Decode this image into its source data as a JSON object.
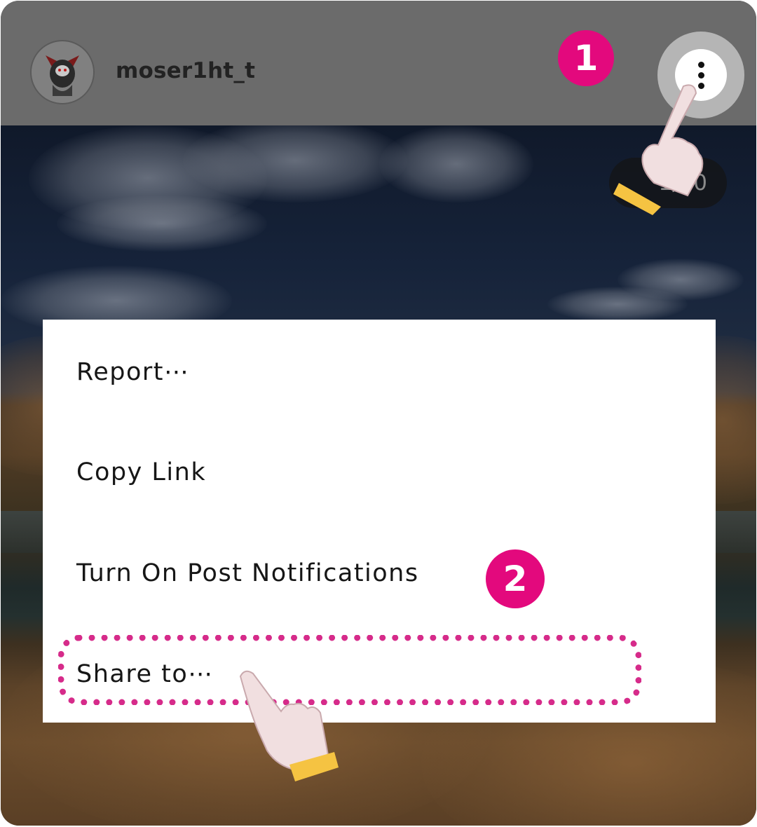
{
  "header": {
    "username": "moser1ht_t",
    "more_icon": "more-vertical-icon"
  },
  "post": {
    "counter": "1/10"
  },
  "steps": {
    "step1": "1",
    "step2": "2"
  },
  "menu": {
    "items": [
      {
        "label": "Report⋯"
      },
      {
        "label": "Copy Link"
      },
      {
        "label": "Turn On Post Notifications"
      },
      {
        "label": "Share to⋯"
      }
    ]
  },
  "colors": {
    "accent": "#e3097d",
    "highlight": "#d62b8a",
    "hand_cuff": "#f5c342",
    "hand_skin": "#f1dfe0"
  }
}
